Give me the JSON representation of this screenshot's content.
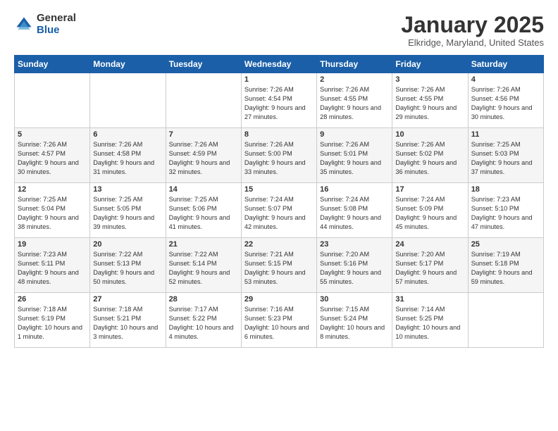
{
  "logo": {
    "general": "General",
    "blue": "Blue"
  },
  "header": {
    "month": "January 2025",
    "location": "Elkridge, Maryland, United States"
  },
  "weekdays": [
    "Sunday",
    "Monday",
    "Tuesday",
    "Wednesday",
    "Thursday",
    "Friday",
    "Saturday"
  ],
  "weeks": [
    [
      {
        "day": "",
        "sunrise": "",
        "sunset": "",
        "daylight": ""
      },
      {
        "day": "",
        "sunrise": "",
        "sunset": "",
        "daylight": ""
      },
      {
        "day": "",
        "sunrise": "",
        "sunset": "",
        "daylight": ""
      },
      {
        "day": "1",
        "sunrise": "Sunrise: 7:26 AM",
        "sunset": "Sunset: 4:54 PM",
        "daylight": "Daylight: 9 hours and 27 minutes."
      },
      {
        "day": "2",
        "sunrise": "Sunrise: 7:26 AM",
        "sunset": "Sunset: 4:55 PM",
        "daylight": "Daylight: 9 hours and 28 minutes."
      },
      {
        "day": "3",
        "sunrise": "Sunrise: 7:26 AM",
        "sunset": "Sunset: 4:55 PM",
        "daylight": "Daylight: 9 hours and 29 minutes."
      },
      {
        "day": "4",
        "sunrise": "Sunrise: 7:26 AM",
        "sunset": "Sunset: 4:56 PM",
        "daylight": "Daylight: 9 hours and 30 minutes."
      }
    ],
    [
      {
        "day": "5",
        "sunrise": "Sunrise: 7:26 AM",
        "sunset": "Sunset: 4:57 PM",
        "daylight": "Daylight: 9 hours and 30 minutes."
      },
      {
        "day": "6",
        "sunrise": "Sunrise: 7:26 AM",
        "sunset": "Sunset: 4:58 PM",
        "daylight": "Daylight: 9 hours and 31 minutes."
      },
      {
        "day": "7",
        "sunrise": "Sunrise: 7:26 AM",
        "sunset": "Sunset: 4:59 PM",
        "daylight": "Daylight: 9 hours and 32 minutes."
      },
      {
        "day": "8",
        "sunrise": "Sunrise: 7:26 AM",
        "sunset": "Sunset: 5:00 PM",
        "daylight": "Daylight: 9 hours and 33 minutes."
      },
      {
        "day": "9",
        "sunrise": "Sunrise: 7:26 AM",
        "sunset": "Sunset: 5:01 PM",
        "daylight": "Daylight: 9 hours and 35 minutes."
      },
      {
        "day": "10",
        "sunrise": "Sunrise: 7:26 AM",
        "sunset": "Sunset: 5:02 PM",
        "daylight": "Daylight: 9 hours and 36 minutes."
      },
      {
        "day": "11",
        "sunrise": "Sunrise: 7:25 AM",
        "sunset": "Sunset: 5:03 PM",
        "daylight": "Daylight: 9 hours and 37 minutes."
      }
    ],
    [
      {
        "day": "12",
        "sunrise": "Sunrise: 7:25 AM",
        "sunset": "Sunset: 5:04 PM",
        "daylight": "Daylight: 9 hours and 38 minutes."
      },
      {
        "day": "13",
        "sunrise": "Sunrise: 7:25 AM",
        "sunset": "Sunset: 5:05 PM",
        "daylight": "Daylight: 9 hours and 39 minutes."
      },
      {
        "day": "14",
        "sunrise": "Sunrise: 7:25 AM",
        "sunset": "Sunset: 5:06 PM",
        "daylight": "Daylight: 9 hours and 41 minutes."
      },
      {
        "day": "15",
        "sunrise": "Sunrise: 7:24 AM",
        "sunset": "Sunset: 5:07 PM",
        "daylight": "Daylight: 9 hours and 42 minutes."
      },
      {
        "day": "16",
        "sunrise": "Sunrise: 7:24 AM",
        "sunset": "Sunset: 5:08 PM",
        "daylight": "Daylight: 9 hours and 44 minutes."
      },
      {
        "day": "17",
        "sunrise": "Sunrise: 7:24 AM",
        "sunset": "Sunset: 5:09 PM",
        "daylight": "Daylight: 9 hours and 45 minutes."
      },
      {
        "day": "18",
        "sunrise": "Sunrise: 7:23 AM",
        "sunset": "Sunset: 5:10 PM",
        "daylight": "Daylight: 9 hours and 47 minutes."
      }
    ],
    [
      {
        "day": "19",
        "sunrise": "Sunrise: 7:23 AM",
        "sunset": "Sunset: 5:11 PM",
        "daylight": "Daylight: 9 hours and 48 minutes."
      },
      {
        "day": "20",
        "sunrise": "Sunrise: 7:22 AM",
        "sunset": "Sunset: 5:13 PM",
        "daylight": "Daylight: 9 hours and 50 minutes."
      },
      {
        "day": "21",
        "sunrise": "Sunrise: 7:22 AM",
        "sunset": "Sunset: 5:14 PM",
        "daylight": "Daylight: 9 hours and 52 minutes."
      },
      {
        "day": "22",
        "sunrise": "Sunrise: 7:21 AM",
        "sunset": "Sunset: 5:15 PM",
        "daylight": "Daylight: 9 hours and 53 minutes."
      },
      {
        "day": "23",
        "sunrise": "Sunrise: 7:20 AM",
        "sunset": "Sunset: 5:16 PM",
        "daylight": "Daylight: 9 hours and 55 minutes."
      },
      {
        "day": "24",
        "sunrise": "Sunrise: 7:20 AM",
        "sunset": "Sunset: 5:17 PM",
        "daylight": "Daylight: 9 hours and 57 minutes."
      },
      {
        "day": "25",
        "sunrise": "Sunrise: 7:19 AM",
        "sunset": "Sunset: 5:18 PM",
        "daylight": "Daylight: 9 hours and 59 minutes."
      }
    ],
    [
      {
        "day": "26",
        "sunrise": "Sunrise: 7:18 AM",
        "sunset": "Sunset: 5:19 PM",
        "daylight": "Daylight: 10 hours and 1 minute."
      },
      {
        "day": "27",
        "sunrise": "Sunrise: 7:18 AM",
        "sunset": "Sunset: 5:21 PM",
        "daylight": "Daylight: 10 hours and 3 minutes."
      },
      {
        "day": "28",
        "sunrise": "Sunrise: 7:17 AM",
        "sunset": "Sunset: 5:22 PM",
        "daylight": "Daylight: 10 hours and 4 minutes."
      },
      {
        "day": "29",
        "sunrise": "Sunrise: 7:16 AM",
        "sunset": "Sunset: 5:23 PM",
        "daylight": "Daylight: 10 hours and 6 minutes."
      },
      {
        "day": "30",
        "sunrise": "Sunrise: 7:15 AM",
        "sunset": "Sunset: 5:24 PM",
        "daylight": "Daylight: 10 hours and 8 minutes."
      },
      {
        "day": "31",
        "sunrise": "Sunrise: 7:14 AM",
        "sunset": "Sunset: 5:25 PM",
        "daylight": "Daylight: 10 hours and 10 minutes."
      },
      {
        "day": "",
        "sunrise": "",
        "sunset": "",
        "daylight": ""
      }
    ]
  ]
}
